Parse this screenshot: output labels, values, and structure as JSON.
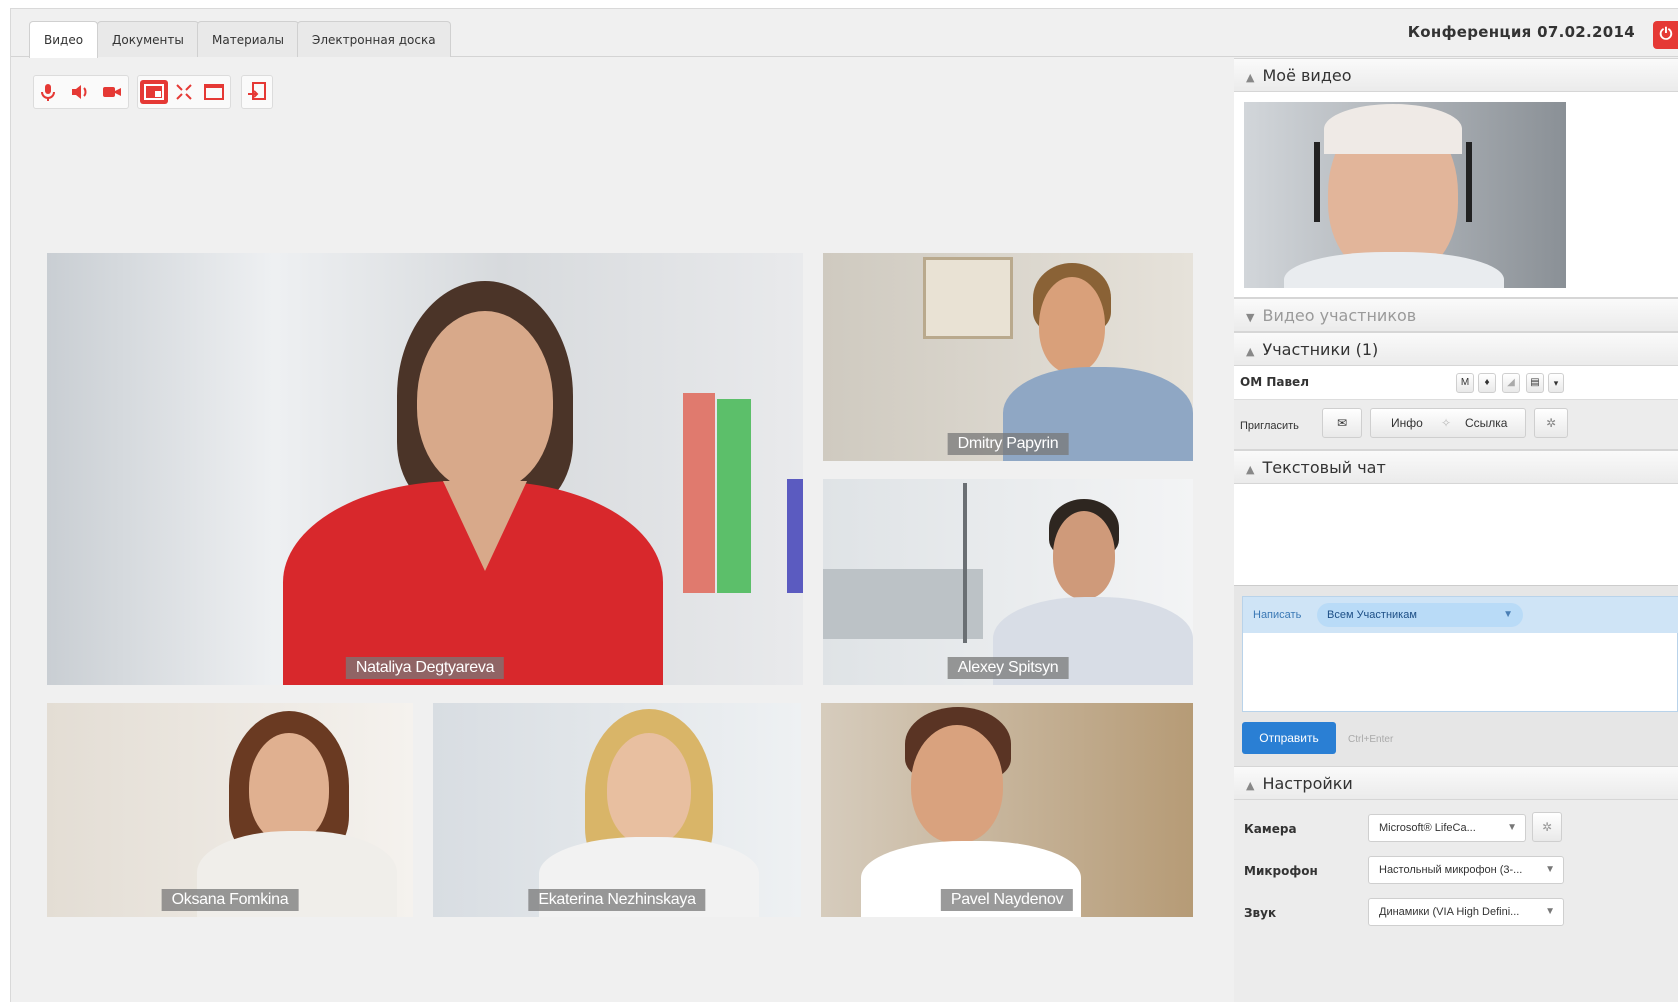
{
  "tabs": [
    {
      "label": "Видео",
      "active": true
    },
    {
      "label": "Документы",
      "active": false
    },
    {
      "label": "Материалы",
      "active": false
    },
    {
      "label": "Электронная доска",
      "active": false
    }
  ],
  "conference_title": "Конференция 07.02.2014",
  "toolbar": {
    "icons": [
      "microphone-icon",
      "speaker-icon",
      "camera-icon",
      "layout-icon",
      "fullscreen-icon",
      "window-icon",
      "exit-icon"
    ]
  },
  "connection_quality": "signal-bars",
  "video_tiles": [
    {
      "name": "Nataliya Degtyareva"
    },
    {
      "name": "Dmitry Papyrin"
    },
    {
      "name": "Alexey Spitsyn"
    },
    {
      "name": "Oksana Fomkina"
    },
    {
      "name": "Ekaterina Nezhinskaya"
    },
    {
      "name": "Pavel Naydenov"
    }
  ],
  "sidebar": {
    "my_video": "Моё видео",
    "participants_video": "Видео участников",
    "participants": "Участники (1)",
    "participant_row": {
      "name": "ОМ Павел",
      "icons": [
        "M",
        "mic-icon",
        "volume-icon",
        "screen-icon",
        "dropdown-icon"
      ]
    },
    "invite": {
      "label": "Пригласить",
      "info": "Инфо",
      "link": "Ссылка"
    },
    "text_chat": "Текстовый чат",
    "compose": {
      "write_label": "Написать",
      "recipient": "Всем Участникам",
      "send": "Отправить",
      "hint": "Ctrl+Enter"
    },
    "settings": {
      "title": "Настройки",
      "camera_label": "Камера",
      "camera_value": "Microsoft® LifeCa...",
      "mic_label": "Микрофон",
      "mic_value": "Настольный микрофон (3-...",
      "sound_label": "Звук",
      "sound_value": "Динамики (VIA High Defini..."
    }
  },
  "colors": {
    "accent": "#e53935",
    "send_button": "#2a7fd4",
    "recipient_pill": "#b9dbf7"
  }
}
